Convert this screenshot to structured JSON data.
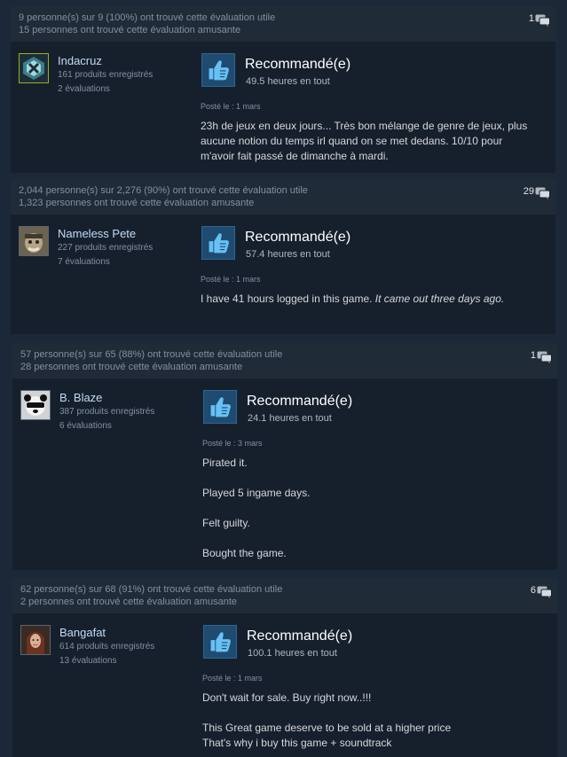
{
  "reviews": [
    {
      "helpful": "9 personne(s) sur 9 (100%) ont trouvé cette évaluation utile",
      "funny": "15 personnes ont trouvé cette évaluation amusante",
      "comments": "1",
      "author": "Indacruz",
      "products": "161 produits enregistrés",
      "reviews_count": "2 évaluations",
      "recommended": "Recommandé(e)",
      "hours": "49.5 heures en tout",
      "posted": "Posté le : 1 mars",
      "body": "23h de jeux en deux jours... Très bon mélange de genre de jeux, plus aucune notion du temps irl quand on se met dedans. 10/10 pour m'avoir fait passé de dimanche à mardi."
    },
    {
      "helpful": "2,044 personne(s) sur 2,276 (90%) ont trouvé cette évaluation utile",
      "funny": "1,323 personnes ont trouvé cette évaluation amusante",
      "comments": "29",
      "author": "Nameless Pete",
      "products": "227 produits enregistrés",
      "reviews_count": "7 évaluations",
      "recommended": "Recommandé(e)",
      "hours": "57.4 heures en tout",
      "posted": "Posté le : 1 mars",
      "body_plain": "I have 41 hours logged in this game. ",
      "body_italic": "It came out three days ago."
    },
    {
      "helpful": "57 personne(s) sur 65 (88%) ont trouvé cette évaluation utile",
      "funny": "28 personnes ont trouvé cette évaluation amusante",
      "comments": "1",
      "author": "B. Blaze",
      "products": "387 produits enregistrés",
      "reviews_count": "6 évaluations",
      "recommended": "Recommandé(e)",
      "hours": "24.1 heures en tout",
      "posted": "Posté le : 3 mars",
      "lines": [
        "Pirated it.",
        "Played 5 ingame days.",
        "Felt guilty.",
        "Bought the game."
      ]
    },
    {
      "helpful": "62 personne(s) sur 68 (91%) ont trouvé cette évaluation utile",
      "funny": "2 personnes ont trouvé cette évaluation amusante",
      "comments": "6",
      "author": "Bangafat",
      "products": "614 produits enregistrés",
      "reviews_count": "13 évaluations",
      "recommended": "Recommandé(e)",
      "hours": "100.1 heures en tout",
      "posted": "Posté le : 1 mars",
      "line1": "Don't wait for sale. Buy right now..!!!",
      "line2": "This Great game deserve to be sold at a higher price",
      "line3": "That's why i buy this game + soundtrack"
    }
  ]
}
